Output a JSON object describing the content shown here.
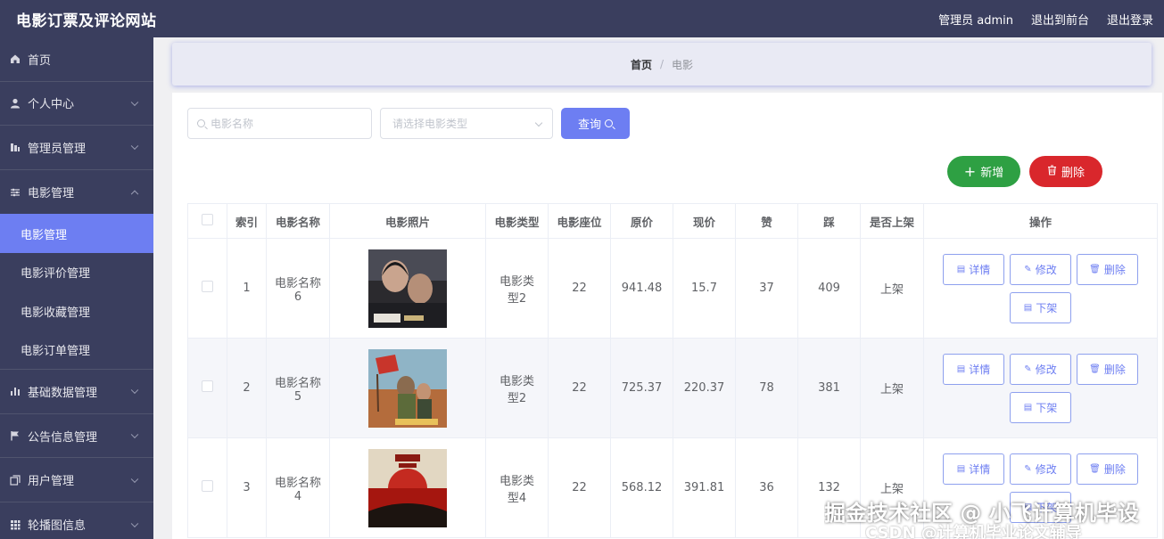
{
  "app_title": "电影订票及评论网站",
  "header": {
    "user": "管理员 admin",
    "to_front": "退出到前台",
    "logout": "退出登录"
  },
  "sidebar": {
    "items": [
      {
        "label": "首页",
        "icon": "home-icon"
      },
      {
        "label": "个人中心",
        "icon": "user-icon"
      },
      {
        "label": "管理员管理",
        "icon": "chart-icon"
      },
      {
        "label": "电影管理",
        "icon": "sliders-icon"
      },
      {
        "label": "基础数据管理",
        "icon": "bar-chart-icon"
      },
      {
        "label": "公告信息管理",
        "icon": "flag-icon"
      },
      {
        "label": "用户管理",
        "icon": "copy-icon"
      },
      {
        "label": "轮播图信息",
        "icon": "grid-icon"
      }
    ],
    "sub_items": [
      "电影管理",
      "电影评价管理",
      "电影收藏管理",
      "电影订单管理"
    ]
  },
  "breadcrumb": {
    "home": "首页",
    "current": "电影"
  },
  "search": {
    "name_placeholder": "电影名称",
    "type_placeholder": "请选择电影类型",
    "query_label": "查询"
  },
  "actions": {
    "add_label": "新增",
    "delete_label": "删除"
  },
  "table": {
    "headers": [
      "索引",
      "电影名称",
      "电影照片",
      "电影类型",
      "电影座位",
      "原价",
      "现价",
      "赞",
      "踩",
      "是否上架",
      "操作"
    ],
    "op_labels": {
      "detail": "详情",
      "edit": "修改",
      "delete": "删除",
      "unlist": "下架"
    },
    "rows": [
      {
        "index": "1",
        "name": "电影名称6",
        "type": "电影类型2",
        "seats": "22",
        "orig_price": "941.48",
        "price": "15.7",
        "likes": "37",
        "dislikes": "409",
        "status": "上架"
      },
      {
        "index": "2",
        "name": "电影名称5",
        "type": "电影类型2",
        "seats": "22",
        "orig_price": "725.37",
        "price": "220.37",
        "likes": "78",
        "dislikes": "381",
        "status": "上架"
      },
      {
        "index": "3",
        "name": "电影名称4",
        "type": "电影类型4",
        "seats": "22",
        "orig_price": "568.12",
        "price": "391.81",
        "likes": "36",
        "dislikes": "132",
        "status": "上架"
      }
    ]
  },
  "watermark": "掘金技术社区 @ 小飞计算机毕设",
  "watermark_sub": "CSDN @计算机毕业论文辅导",
  "colors": {
    "sidebar_bg": "#3a3e5e",
    "accent": "#6d7ef2",
    "add_green": "#2ea043",
    "delete_red": "#d9272c"
  }
}
